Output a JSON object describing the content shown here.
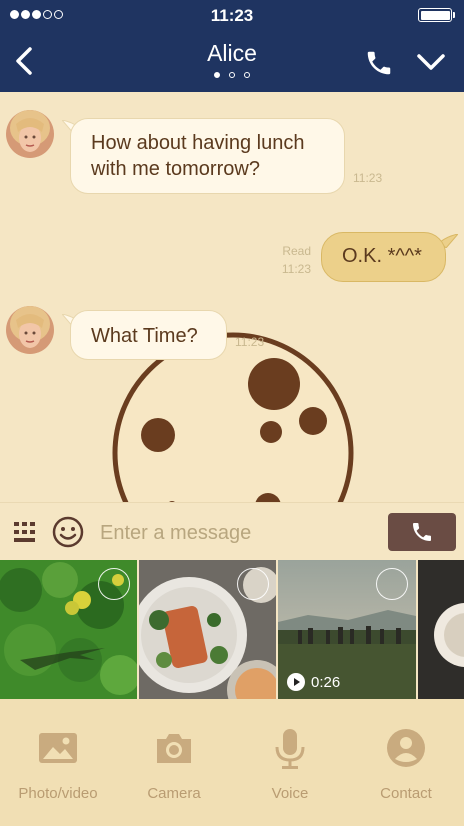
{
  "status_bar": {
    "time": "11:23"
  },
  "header": {
    "title": "Alice"
  },
  "messages": [
    {
      "from": "Alice",
      "text_line1": "How about having lunch",
      "text_line2": "with me tomorrow?",
      "time": "11:23"
    },
    {
      "from": "me",
      "text": "O.K. *^^*",
      "read_label": "Read",
      "time": "11:23"
    },
    {
      "from": "Alice",
      "text": "What Time?",
      "time": "11:23"
    }
  ],
  "input": {
    "placeholder": "Enter a message"
  },
  "media_strip": {
    "video_duration": "0:26"
  },
  "tabs": [
    {
      "label": "Photo/video",
      "icon": "photo-icon"
    },
    {
      "label": "Camera",
      "icon": "camera-icon"
    },
    {
      "label": "Voice",
      "icon": "microphone-icon"
    },
    {
      "label": "Contact",
      "icon": "contact-icon"
    }
  ],
  "colors": {
    "header_bg": "#1f3461",
    "chat_bg": "#f5e6c4",
    "bubble_out": "#ecd08a",
    "accent_brown": "#6a4c44"
  }
}
